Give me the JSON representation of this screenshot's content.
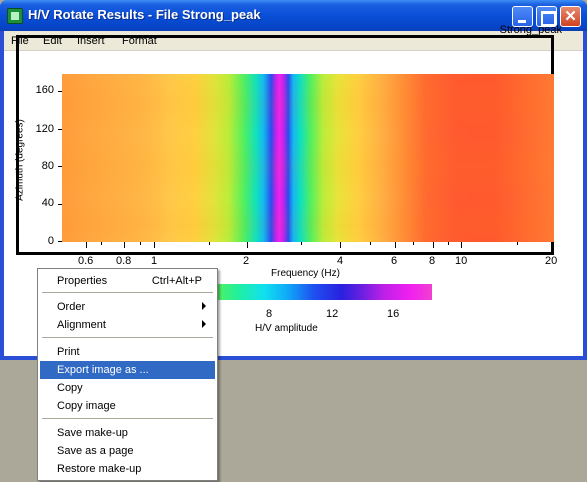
{
  "window": {
    "title": "H/V Rotate Results - File Strong_peak"
  },
  "menubar": {
    "items": [
      "File",
      "Edit",
      "Insert",
      "Format"
    ]
  },
  "graph": {
    "name": "Strong_peak",
    "x_title": "Frequency (Hz)",
    "y_title": "Azimuth (degrees)",
    "y_ticks": [
      "160",
      "120",
      "80",
      "40",
      "0"
    ],
    "x_ticks": [
      "0.6",
      "0.8",
      "1",
      "2",
      "4",
      "6",
      "8",
      "10",
      "20"
    ]
  },
  "colorbar": {
    "ticks": [
      "8",
      "12",
      "16"
    ],
    "title": "H/V amplitude"
  },
  "context_menu": {
    "items": [
      {
        "label": "Properties",
        "shortcut": "Ctrl+Alt+P"
      },
      {
        "label": "Order"
      },
      {
        "label": "Alignment"
      },
      {
        "label": "Print"
      },
      {
        "label": "Export image as ..."
      },
      {
        "label": "Copy"
      },
      {
        "label": "Copy image"
      },
      {
        "label": "Save make-up"
      },
      {
        "label": "Save as a page"
      },
      {
        "label": "Restore make-up"
      }
    ]
  },
  "colors": {
    "title_bar": "#0a4fd8",
    "menu_highlight": "#316ac5",
    "peak_color": "#f020f0"
  }
}
